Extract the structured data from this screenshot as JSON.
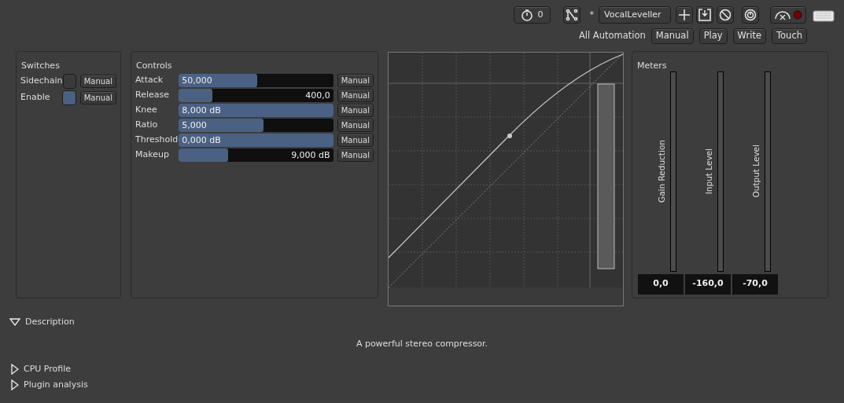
{
  "toolbar": {
    "timer_count": "0",
    "modified_mark": "*",
    "preset": "VocalLeveller",
    "automation_label": "All Automation",
    "automation_buttons": [
      {
        "label": "Manual"
      },
      {
        "label": "Play"
      },
      {
        "label": "Write"
      },
      {
        "label": "Touch"
      }
    ]
  },
  "switches": {
    "title": "Switches",
    "items": [
      {
        "label": "Sidechain",
        "checked": false,
        "mode": "Manual"
      },
      {
        "label": "Enable",
        "checked": true,
        "mode": "Manual"
      }
    ]
  },
  "controls": {
    "title": "Controls",
    "items": [
      {
        "label": "Attack",
        "value": "50,000",
        "kind": "start",
        "level": 0.51,
        "mode": "Manual"
      },
      {
        "label": "Release",
        "value": "400,0",
        "kind": "end",
        "level": 0.22,
        "mode": "Manual"
      },
      {
        "label": "Knee",
        "value": "8,000 dB",
        "kind": "start",
        "level": 1,
        "mode": "Manual"
      },
      {
        "label": "Ratio",
        "value": "5,000",
        "kind": "start",
        "level": 0.55,
        "mode": "Manual"
      },
      {
        "label": "Threshold",
        "value": "0,000 dB",
        "kind": "start",
        "level": 1,
        "mode": "Manual"
      },
      {
        "label": "Makeup",
        "value": "9,000 dB",
        "kind": "end",
        "level": 0.32,
        "mode": "Manual"
      }
    ]
  },
  "meters": {
    "title": "Meters",
    "items": [
      {
        "label": "Gain Reduction",
        "reading": "0,0"
      },
      {
        "label": "Input Level",
        "reading": "-160,0"
      },
      {
        "label": "Output Level",
        "reading": "-70,0"
      }
    ]
  },
  "sections": [
    {
      "title": "Description",
      "expanded": true,
      "text": "A powerful stereo compressor."
    },
    {
      "title": "CPU Profile",
      "expanded": false
    },
    {
      "title": "Plugin analysis",
      "expanded": false
    }
  ]
}
